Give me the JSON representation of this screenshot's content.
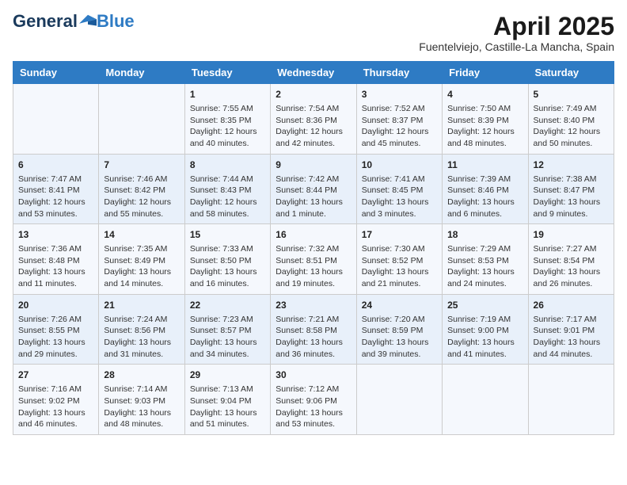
{
  "header": {
    "logo_general": "General",
    "logo_blue": "Blue",
    "month_title": "April 2025",
    "location": "Fuentelviejo, Castille-La Mancha, Spain"
  },
  "weekdays": [
    "Sunday",
    "Monday",
    "Tuesday",
    "Wednesday",
    "Thursday",
    "Friday",
    "Saturday"
  ],
  "weeks": [
    [
      {
        "day": "",
        "info": ""
      },
      {
        "day": "",
        "info": ""
      },
      {
        "day": "1",
        "info": "Sunrise: 7:55 AM\nSunset: 8:35 PM\nDaylight: 12 hours and 40 minutes."
      },
      {
        "day": "2",
        "info": "Sunrise: 7:54 AM\nSunset: 8:36 PM\nDaylight: 12 hours and 42 minutes."
      },
      {
        "day": "3",
        "info": "Sunrise: 7:52 AM\nSunset: 8:37 PM\nDaylight: 12 hours and 45 minutes."
      },
      {
        "day": "4",
        "info": "Sunrise: 7:50 AM\nSunset: 8:39 PM\nDaylight: 12 hours and 48 minutes."
      },
      {
        "day": "5",
        "info": "Sunrise: 7:49 AM\nSunset: 8:40 PM\nDaylight: 12 hours and 50 minutes."
      }
    ],
    [
      {
        "day": "6",
        "info": "Sunrise: 7:47 AM\nSunset: 8:41 PM\nDaylight: 12 hours and 53 minutes."
      },
      {
        "day": "7",
        "info": "Sunrise: 7:46 AM\nSunset: 8:42 PM\nDaylight: 12 hours and 55 minutes."
      },
      {
        "day": "8",
        "info": "Sunrise: 7:44 AM\nSunset: 8:43 PM\nDaylight: 12 hours and 58 minutes."
      },
      {
        "day": "9",
        "info": "Sunrise: 7:42 AM\nSunset: 8:44 PM\nDaylight: 13 hours and 1 minute."
      },
      {
        "day": "10",
        "info": "Sunrise: 7:41 AM\nSunset: 8:45 PM\nDaylight: 13 hours and 3 minutes."
      },
      {
        "day": "11",
        "info": "Sunrise: 7:39 AM\nSunset: 8:46 PM\nDaylight: 13 hours and 6 minutes."
      },
      {
        "day": "12",
        "info": "Sunrise: 7:38 AM\nSunset: 8:47 PM\nDaylight: 13 hours and 9 minutes."
      }
    ],
    [
      {
        "day": "13",
        "info": "Sunrise: 7:36 AM\nSunset: 8:48 PM\nDaylight: 13 hours and 11 minutes."
      },
      {
        "day": "14",
        "info": "Sunrise: 7:35 AM\nSunset: 8:49 PM\nDaylight: 13 hours and 14 minutes."
      },
      {
        "day": "15",
        "info": "Sunrise: 7:33 AM\nSunset: 8:50 PM\nDaylight: 13 hours and 16 minutes."
      },
      {
        "day": "16",
        "info": "Sunrise: 7:32 AM\nSunset: 8:51 PM\nDaylight: 13 hours and 19 minutes."
      },
      {
        "day": "17",
        "info": "Sunrise: 7:30 AM\nSunset: 8:52 PM\nDaylight: 13 hours and 21 minutes."
      },
      {
        "day": "18",
        "info": "Sunrise: 7:29 AM\nSunset: 8:53 PM\nDaylight: 13 hours and 24 minutes."
      },
      {
        "day": "19",
        "info": "Sunrise: 7:27 AM\nSunset: 8:54 PM\nDaylight: 13 hours and 26 minutes."
      }
    ],
    [
      {
        "day": "20",
        "info": "Sunrise: 7:26 AM\nSunset: 8:55 PM\nDaylight: 13 hours and 29 minutes."
      },
      {
        "day": "21",
        "info": "Sunrise: 7:24 AM\nSunset: 8:56 PM\nDaylight: 13 hours and 31 minutes."
      },
      {
        "day": "22",
        "info": "Sunrise: 7:23 AM\nSunset: 8:57 PM\nDaylight: 13 hours and 34 minutes."
      },
      {
        "day": "23",
        "info": "Sunrise: 7:21 AM\nSunset: 8:58 PM\nDaylight: 13 hours and 36 minutes."
      },
      {
        "day": "24",
        "info": "Sunrise: 7:20 AM\nSunset: 8:59 PM\nDaylight: 13 hours and 39 minutes."
      },
      {
        "day": "25",
        "info": "Sunrise: 7:19 AM\nSunset: 9:00 PM\nDaylight: 13 hours and 41 minutes."
      },
      {
        "day": "26",
        "info": "Sunrise: 7:17 AM\nSunset: 9:01 PM\nDaylight: 13 hours and 44 minutes."
      }
    ],
    [
      {
        "day": "27",
        "info": "Sunrise: 7:16 AM\nSunset: 9:02 PM\nDaylight: 13 hours and 46 minutes."
      },
      {
        "day": "28",
        "info": "Sunrise: 7:14 AM\nSunset: 9:03 PM\nDaylight: 13 hours and 48 minutes."
      },
      {
        "day": "29",
        "info": "Sunrise: 7:13 AM\nSunset: 9:04 PM\nDaylight: 13 hours and 51 minutes."
      },
      {
        "day": "30",
        "info": "Sunrise: 7:12 AM\nSunset: 9:06 PM\nDaylight: 13 hours and 53 minutes."
      },
      {
        "day": "",
        "info": ""
      },
      {
        "day": "",
        "info": ""
      },
      {
        "day": "",
        "info": ""
      }
    ]
  ]
}
